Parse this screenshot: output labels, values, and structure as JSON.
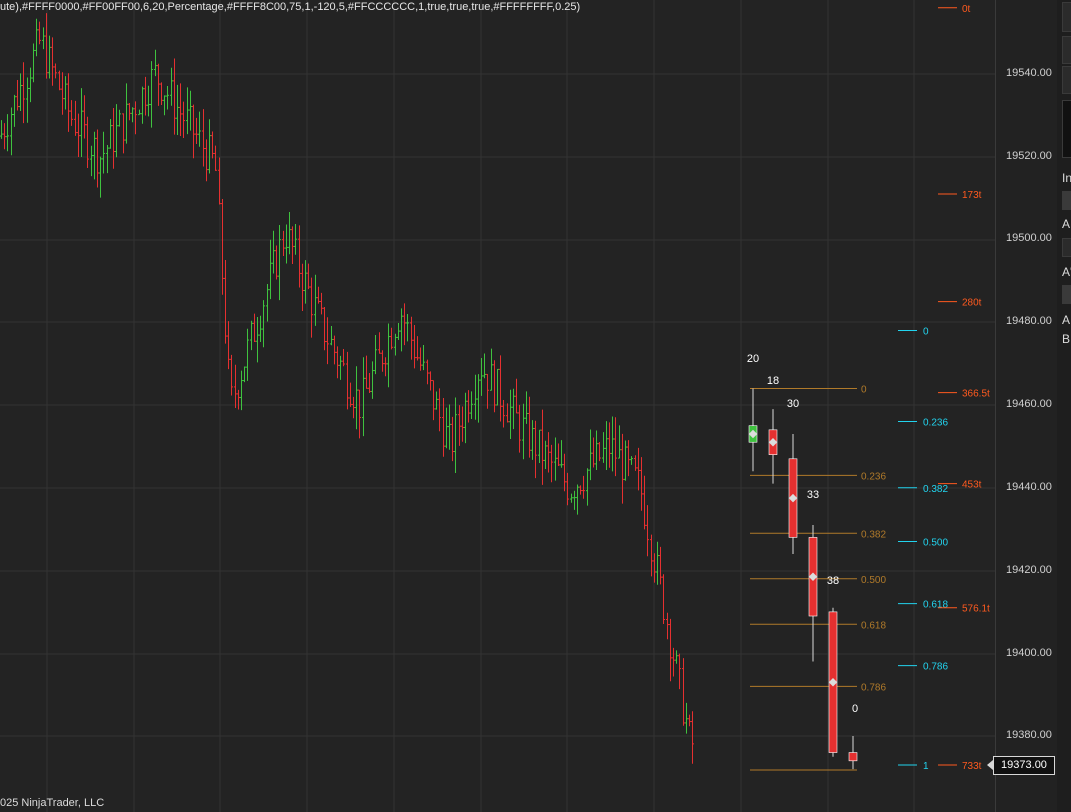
{
  "indicator_params": "ute),#FFFF0000,#FF00FF00,6,20,Percentage,#FFFF8C00,75,1,-120,5,#FFCCCCCC,1,true,true,true,#FFFFFFFF,0.25)",
  "copyright": "025 NinjaTrader, LLC",
  "colors": {
    "background": "#232323",
    "grid": "#333333",
    "up": "#3fc23f",
    "down": "#e53030",
    "fib_gold": "#b07a2a",
    "fib_cyan": "#22d3ee",
    "tick_orange": "#ff5a1f",
    "white": "#ffffff"
  },
  "price_axis": {
    "ticks": [
      "19540.00",
      "19520.00",
      "19500.00",
      "19480.00",
      "19460.00",
      "19440.00",
      "19420.00",
      "19400.00",
      "19380.00"
    ],
    "current_price": "19373.00"
  },
  "fib_gold_labels": [
    "0",
    "0.236",
    "0.382",
    "0.500",
    "0.618",
    "0.786"
  ],
  "fib_cyan_labels": [
    "0",
    "0.236",
    "0.382",
    "0.500",
    "0.618",
    "0.786",
    "1"
  ],
  "tick_labels": [
    "0t",
    "173t",
    "280t",
    "366.5t",
    "453t",
    "576.1t",
    "733t"
  ],
  "candle_labels": [
    "20",
    "18",
    "30",
    "33",
    "38",
    "0"
  ],
  "side_panel": {
    "labels": [
      "In",
      "A",
      "A'",
      "A",
      "B"
    ]
  },
  "chart_data": {
    "type": "candlestick",
    "ylim": [
      19367,
      19558
    ],
    "grid": true,
    "big_candles": [
      {
        "open": 19451,
        "high": 19464,
        "low": 19444,
        "close": 19455,
        "dir": "up"
      },
      {
        "open": 19454,
        "high": 19459,
        "low": 19441,
        "close": 19448,
        "dir": "down"
      },
      {
        "open": 19447,
        "high": 19453,
        "low": 19424,
        "close": 19428,
        "dir": "down"
      },
      {
        "open": 19428,
        "high": 19431,
        "low": 19398,
        "close": 19409,
        "dir": "down"
      },
      {
        "open": 19410,
        "high": 19411,
        "low": 19375,
        "close": 19376,
        "dir": "down"
      },
      {
        "open": 19376,
        "high": 19380,
        "low": 19372,
        "close": 19374,
        "dir": "down"
      }
    ],
    "fib_gold_levels": [
      19464,
      19443,
      19429,
      19418,
      19407,
      19392
    ],
    "fib_cyan_levels": [
      19478,
      19456,
      19440,
      19427,
      19412,
      19397,
      19373
    ],
    "tick_levels": [
      19556,
      19511,
      19485,
      19463,
      19441,
      19411,
      19373
    ]
  }
}
